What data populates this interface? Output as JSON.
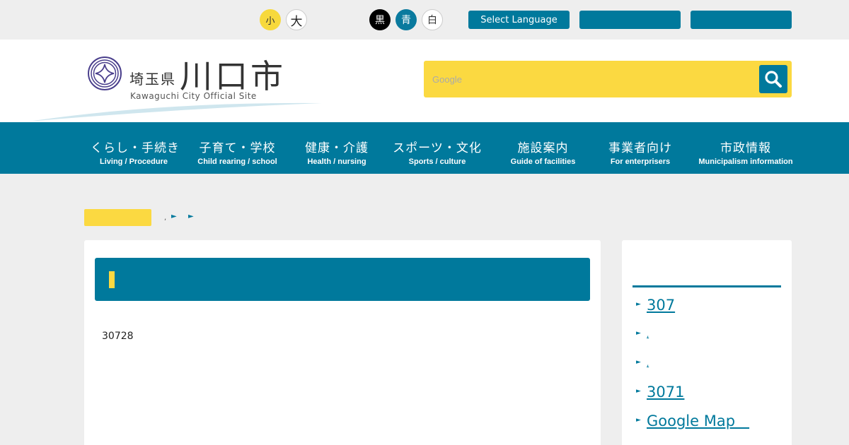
{
  "topbar": {
    "font_size_small": "小",
    "font_size_large": "大",
    "color_black": "黒",
    "color_blue": "青",
    "color_white": "白",
    "select_language": "Select Language",
    "button2": "",
    "button3": ""
  },
  "header": {
    "prefecture": "埼玉県",
    "city": "川口市",
    "subtitle": "Kawaguchi City Official Site",
    "search_placeholder": "Google"
  },
  "nav": [
    {
      "jp": "くらし・手続き",
      "en": "Living / Procedure"
    },
    {
      "jp": "子育て・学校",
      "en": "Child rearing / school"
    },
    {
      "jp": "健康・介護",
      "en": "Health / nursing"
    },
    {
      "jp": "スポーツ・文化",
      "en": "Sports / culture"
    },
    {
      "jp": "施設案内",
      "en": "Guide of facilities"
    },
    {
      "jp": "事業者向け",
      "en": "For enterprisers"
    },
    {
      "jp": "市政情報",
      "en": "Municipalism  information"
    }
  ],
  "breadcrumb": {
    "home": "",
    "dot": ",",
    "sep": "►"
  },
  "main": {
    "title": "",
    "body": "30728"
  },
  "sidebar": {
    "heading": "",
    "links": [
      "307",
      ",",
      ",",
      "3071",
      "Google Map   ",
      ""
    ]
  },
  "colors": {
    "primary": "#00799c",
    "accent": "#fbd941",
    "background": "#eeeeee"
  }
}
